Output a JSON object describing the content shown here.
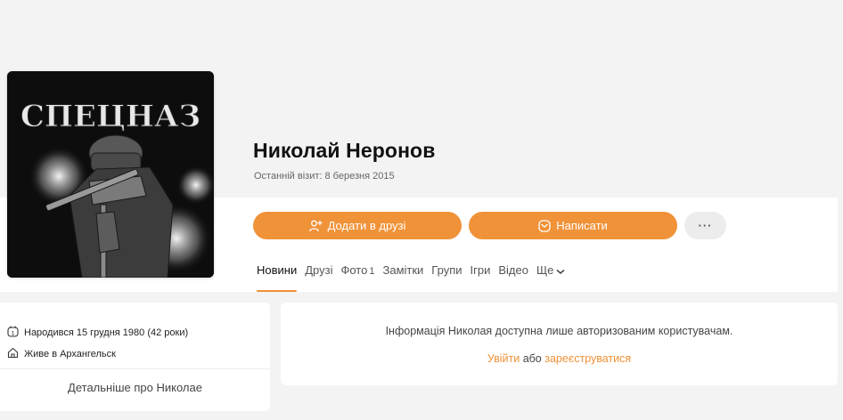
{
  "profile": {
    "name": "Николай Неронов",
    "last_visit": "Останній візит: 8 березня 2015",
    "avatar_text": "СПЕЦНАЗ"
  },
  "actions": {
    "add_friend_label": "Додати в друзі",
    "write_label": "Написати",
    "more_label": "···"
  },
  "tabs": [
    {
      "label": "Новини",
      "active": true
    },
    {
      "label": "Друзі"
    },
    {
      "label": "Фото",
      "count": "1"
    },
    {
      "label": "Замітки"
    },
    {
      "label": "Групи"
    },
    {
      "label": "Ігри"
    },
    {
      "label": "Відео"
    },
    {
      "label": "Ще"
    }
  ],
  "about": {
    "birthday": "Народився 15 грудня 1980 (42 роки)",
    "location": "Живе в Архангельск",
    "details_link": "Детальніше про Николае"
  },
  "notice": {
    "restricted_text": "Інформація Николая доступна лише авторизованим користувачам.",
    "login_link": "Увійти",
    "or_text": "або",
    "register_link": "зареєструватися"
  },
  "colors": {
    "accent": "#f09238",
    "background": "#f3f3f3",
    "card": "#ffffff"
  },
  "icons": {
    "add_friend": "add-user-icon",
    "write": "envelope-icon",
    "more": "more-dots-icon",
    "birthday": "calendar-icon",
    "location": "house-icon",
    "tab_more": "chevron-down-icon"
  }
}
